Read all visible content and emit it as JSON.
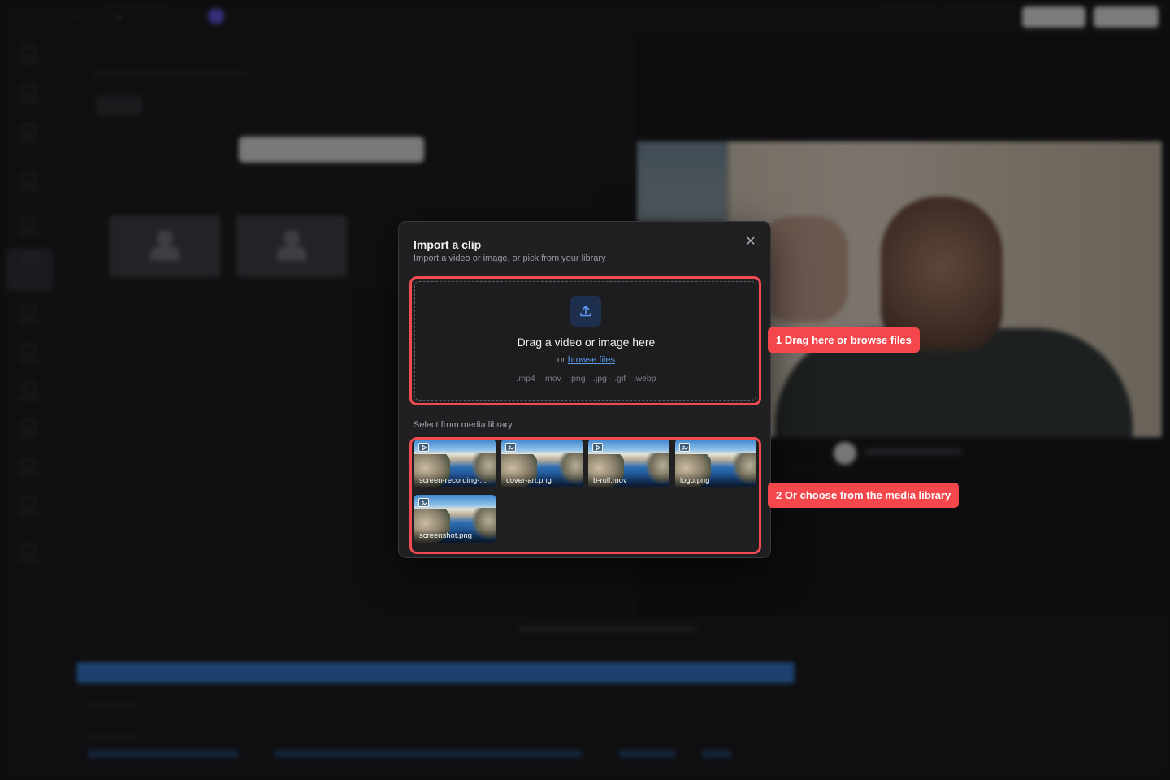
{
  "modal": {
    "title": "Import a clip",
    "subtitle": "Import a video or image, or pick from your library",
    "close_icon": "close-icon",
    "dropzone": {
      "icon": "upload-icon",
      "main_text": "Drag a video or image here",
      "or_text": "or",
      "browse_link": "browse files",
      "file_types": ".mp4 · .mov · .png · .jpg · .gif · .webp"
    },
    "library": {
      "label": "Select from media library",
      "items": [
        {
          "name": "screen-recording-...",
          "kind": "video"
        },
        {
          "name": "cover-art.png",
          "kind": "image"
        },
        {
          "name": "b-roll.mov",
          "kind": "video"
        },
        {
          "name": "logo.png",
          "kind": "image"
        },
        {
          "name": "screenshot.png",
          "kind": "image"
        }
      ]
    }
  },
  "callouts": {
    "first": "1 Drag here or browse files",
    "second": "2 Or choose from the media library"
  },
  "colors": {
    "highlight": "#f04b4f",
    "callout_bg": "#f4474c",
    "link": "#5b9cf2",
    "upload_icon_bg": "#1e2f4d",
    "timeline_track": "#2f6fc1"
  }
}
